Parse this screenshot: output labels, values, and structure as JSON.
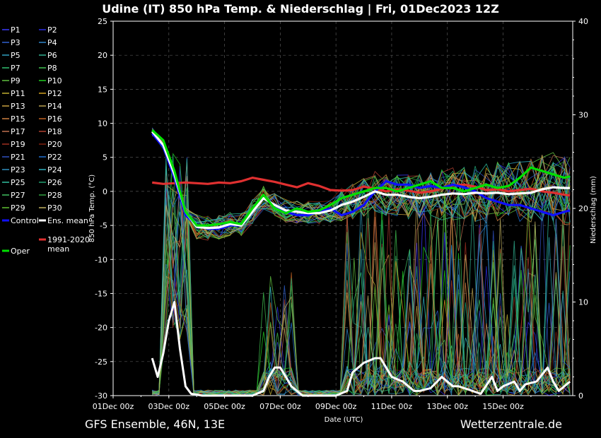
{
  "chart_data": {
    "type": "line",
    "title": "Udine  (IT)  850 hPa Temp. & Niederschlag | Fri, 01Dec2023 12Z",
    "subtitle_left": "GFS Ensemble, 46N, 13E",
    "subtitle_right": "Wetterzentrale.de",
    "xlabel": "Date (UTC)",
    "ylabel_left": "850 hPa Temp. (°C)",
    "ylabel_right": "Niederschlag (mm)",
    "ylim_left": [
      -30,
      25
    ],
    "ylim_right": [
      0,
      40
    ],
    "yticks_left": [
      25,
      20,
      15,
      10,
      5,
      0,
      -5,
      -10,
      -15,
      -20,
      -25,
      -30
    ],
    "yticks_right": [
      40,
      30,
      20,
      10,
      0
    ],
    "x_days": [
      0,
      2,
      4,
      6,
      8,
      10,
      12,
      14
    ],
    "xtick_labels": [
      "01Dec 00z",
      "03Dec 00z",
      "05Dec 00z",
      "07Dec 00z",
      "09Dec 00z",
      "11Dec 00z",
      "13Dec 00z",
      "15Dec 00z"
    ],
    "grid": true,
    "legend_position": "left",
    "colors": {
      "control": "#1010ff",
      "ens_mean": "#ffffff",
      "climate": "#e03030",
      "oper": "#00e000"
    },
    "legend": [
      {
        "name": "P1",
        "color": "#3a3aff"
      },
      {
        "name": "P2",
        "color": "#2a2ae0"
      },
      {
        "name": "P3",
        "color": "#3060d0"
      },
      {
        "name": "P4",
        "color": "#2f86c8"
      },
      {
        "name": "P5",
        "color": "#30a0c0"
      },
      {
        "name": "P6",
        "color": "#30b090"
      },
      {
        "name": "P7",
        "color": "#30c070"
      },
      {
        "name": "P8",
        "color": "#40c050"
      },
      {
        "name": "P9",
        "color": "#60c040"
      },
      {
        "name": "P10",
        "color": "#20d020"
      },
      {
        "name": "P11",
        "color": "#c0b030"
      },
      {
        "name": "P12",
        "color": "#d0a020"
      },
      {
        "name": "P13",
        "color": "#c8a040"
      },
      {
        "name": "P14",
        "color": "#b8a050"
      },
      {
        "name": "P15",
        "color": "#d08040"
      },
      {
        "name": "P16",
        "color": "#c06020"
      },
      {
        "name": "P17",
        "color": "#c07050"
      },
      {
        "name": "P18",
        "color": "#b04030"
      },
      {
        "name": "P19",
        "color": "#a03020"
      },
      {
        "name": "P20",
        "color": "#802010"
      },
      {
        "name": "P21",
        "color": "#3050c0"
      },
      {
        "name": "P22",
        "color": "#2070d0"
      },
      {
        "name": "P23",
        "color": "#3090c0"
      },
      {
        "name": "P24",
        "color": "#30b0c0"
      },
      {
        "name": "P25",
        "color": "#30c0a0"
      },
      {
        "name": "P26",
        "color": "#20a070"
      },
      {
        "name": "P27",
        "color": "#40c060"
      },
      {
        "name": "P28",
        "color": "#30a040"
      },
      {
        "name": "P29",
        "color": "#60c030"
      },
      {
        "name": "P30",
        "color": "#c0b060"
      },
      {
        "name": "Control",
        "color": "#1010ff"
      },
      {
        "name": "Ens. mean",
        "color": "#ffffff"
      },
      {
        "name": "1991-2020\nmean",
        "color": "#e03030"
      },
      {
        "name": "Oper",
        "color": "#00e000"
      }
    ],
    "series_temperature": [
      {
        "name": "1991-2020 mean",
        "color": "#e03030",
        "x": [
          1.4,
          1.8,
          2.2,
          2.6,
          3.0,
          3.4,
          3.8,
          4.2,
          4.6,
          5.0,
          5.4,
          5.8,
          6.2,
          6.6,
          7.0,
          7.4,
          7.8,
          8.2,
          8.6,
          9.0,
          9.4,
          9.8,
          10.2,
          10.6,
          11.0,
          11.4,
          11.8,
          12.2,
          12.6,
          13.0,
          13.4,
          13.8,
          14.2,
          14.6,
          15.0,
          15.4,
          15.8,
          16.2,
          16.4
        ],
        "y": [
          1.3,
          1.1,
          1.2,
          1.3,
          1.2,
          1.1,
          1.3,
          1.2,
          1.5,
          2.0,
          1.7,
          1.4,
          1.0,
          0.6,
          1.2,
          0.8,
          0.2,
          0.1,
          0.2,
          0.7,
          0.4,
          0.0,
          0.3,
          0.1,
          -0.2,
          0.0,
          0.4,
          0.9,
          1.0,
          0.7,
          0.2,
          0.3,
          0.0,
          0.2,
          0.4,
          0.0,
          -0.2,
          -0.5,
          -0.6
        ]
      },
      {
        "name": "Control",
        "color": "#1010ff",
        "x": [
          1.4,
          1.8,
          2.2,
          2.6,
          3.0,
          3.4,
          3.8,
          4.2,
          4.6,
          5.0,
          5.4,
          5.8,
          6.2,
          6.6,
          7.0,
          7.4,
          7.8,
          8.2,
          8.6,
          9.0,
          9.4,
          9.8,
          10.2,
          10.6,
          11.0,
          11.4,
          11.8,
          12.2,
          12.6,
          13.0,
          13.4,
          13.8,
          14.2,
          14.6,
          15.0,
          15.4,
          15.8,
          16.2,
          16.4
        ],
        "y": [
          8.5,
          6.5,
          2.0,
          -3.5,
          -5.0,
          -5.5,
          -5.5,
          -5.0,
          -5.0,
          -3.0,
          -1.0,
          -2.0,
          -3.0,
          -3.5,
          -3.5,
          -3.0,
          -2.5,
          -3.5,
          -3.0,
          -2.0,
          0.0,
          1.5,
          1.0,
          1.0,
          0.5,
          0.8,
          0.5,
          1.0,
          0.6,
          0.0,
          -1.0,
          -1.5,
          -2.0,
          -2.0,
          -2.5,
          -3.0,
          -3.5,
          -3.0,
          -2.8
        ]
      },
      {
        "name": "Ens. mean",
        "color": "#ffffff",
        "x": [
          1.4,
          1.8,
          2.2,
          2.6,
          3.0,
          3.4,
          3.8,
          4.2,
          4.6,
          5.0,
          5.4,
          5.8,
          6.2,
          6.6,
          7.0,
          7.4,
          7.8,
          8.2,
          8.6,
          9.0,
          9.4,
          9.8,
          10.2,
          10.6,
          11.0,
          11.4,
          11.8,
          12.2,
          12.6,
          13.0,
          13.4,
          13.8,
          14.2,
          14.6,
          15.0,
          15.4,
          15.8,
          16.2,
          16.4
        ],
        "y": [
          8.8,
          6.8,
          2.5,
          -3.0,
          -5.2,
          -5.4,
          -5.3,
          -4.8,
          -5.0,
          -3.0,
          -1.0,
          -2.0,
          -2.8,
          -3.0,
          -3.2,
          -3.2,
          -2.8,
          -2.0,
          -1.5,
          -0.8,
          0.0,
          -0.5,
          -0.5,
          -0.8,
          -1.0,
          -0.8,
          -0.5,
          -0.3,
          -0.4,
          -0.2,
          -0.3,
          -0.2,
          -0.4,
          -0.3,
          -0.2,
          0.3,
          0.6,
          0.5,
          0.5
        ]
      },
      {
        "name": "Oper",
        "color": "#00e000",
        "x": [
          1.4,
          1.8,
          2.2,
          2.6,
          3.0,
          3.4,
          3.8,
          4.2,
          4.6,
          5.0,
          5.4,
          5.8,
          6.2,
          6.6,
          7.0,
          7.4,
          7.8,
          8.2,
          8.6,
          9.0,
          9.4,
          9.8,
          10.2,
          10.6,
          11.0,
          11.4,
          11.8,
          12.2,
          12.6,
          13.0,
          13.4,
          13.8,
          14.2,
          14.6,
          15.0,
          15.4,
          15.8,
          16.2,
          16.4
        ],
        "y": [
          9.0,
          7.5,
          3.0,
          -3.0,
          -5.0,
          -5.0,
          -4.8,
          -4.5,
          -4.8,
          -2.5,
          -0.5,
          -2.5,
          -3.2,
          -2.5,
          -3.0,
          -2.8,
          -2.0,
          -1.0,
          -0.5,
          0.0,
          0.5,
          0.5,
          0.0,
          0.5,
          1.0,
          1.5,
          0.5,
          0.5,
          0.0,
          0.5,
          1.0,
          0.5,
          0.8,
          2.0,
          3.5,
          3.0,
          2.5,
          2.0,
          2.2
        ]
      }
    ],
    "series_precipitation_mm": [
      {
        "name": "Ens. mean",
        "color": "#ffffff",
        "x": [
          1.4,
          1.6,
          1.8,
          2.0,
          2.2,
          2.4,
          2.6,
          2.8,
          3.2,
          4.0,
          5.0,
          5.4,
          5.6,
          5.8,
          6.0,
          6.4,
          6.8,
          8.0,
          8.4,
          8.6,
          8.8,
          9.0,
          9.4,
          9.6,
          9.8,
          10.0,
          10.4,
          10.8,
          11.0,
          11.4,
          11.8,
          12.2,
          12.4,
          12.8,
          13.2,
          13.6,
          13.8,
          14.0,
          14.4,
          14.6,
          14.8,
          15.2,
          15.6,
          15.8,
          16.0,
          16.4
        ],
        "y": [
          4.0,
          2.0,
          4.5,
          8.0,
          10.0,
          5.0,
          1.0,
          0.2,
          0.0,
          0.0,
          0.0,
          0.5,
          2.0,
          3.0,
          3.0,
          1.0,
          0.0,
          0.0,
          0.5,
          2.5,
          3.0,
          3.5,
          4.0,
          4.0,
          3.0,
          2.0,
          1.5,
          0.5,
          0.5,
          0.8,
          2.0,
          1.0,
          1.0,
          0.6,
          0.2,
          2.0,
          0.5,
          1.0,
          1.5,
          0.5,
          1.2,
          1.5,
          3.0,
          1.5,
          0.5,
          1.5
        ]
      }
    ],
    "member_range_note": ""
  }
}
